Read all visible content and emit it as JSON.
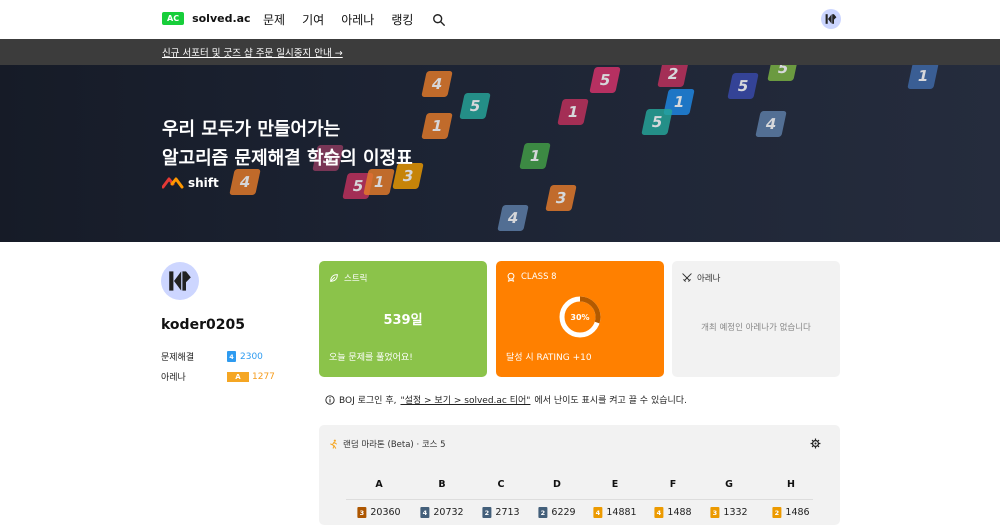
{
  "nav": {
    "logo_badge": "AC",
    "logo_text": "solved.ac",
    "links": [
      "문제",
      "기여",
      "아레나",
      "랭킹"
    ]
  },
  "notice": {
    "text": "신규 서포터 및 굿즈 샵 주문 일시중지 안내 →"
  },
  "hero": {
    "title_line1": "우리 모두가 만들어가는",
    "title_line2": "알고리즘 문제해결 학습의 이정표",
    "brand": "shift"
  },
  "profile": {
    "username": "koder0205",
    "solved_label": "문제해결",
    "solved_tier_digit": "4",
    "solved_value": "2300",
    "arena_label": "아레나",
    "arena_badge": "A",
    "arena_value": "1277"
  },
  "cards": {
    "streak": {
      "label": "스트릭",
      "big": "539일",
      "foot": "오늘 문제를 풀었어요!"
    },
    "class": {
      "label": "CLASS 8",
      "percent_text": "30%",
      "progress": 0.3,
      "foot": "달성 시 RATING +10"
    },
    "arena": {
      "label": "아레나",
      "empty": "개최 예정인 아레나가 없습니다"
    }
  },
  "info": {
    "prefix": "BOJ 로그인 후, ",
    "link": "\"설정 > 보기 > solved.ac 티어\"",
    "suffix": "에서 난이도 표시를 켜고 끌 수 있습니다."
  },
  "marathon": {
    "title": "랜덤 마라톤 (Beta) · 코스 5",
    "columns": [
      {
        "letter": "A",
        "tier_digit": "3",
        "tier_color": "#ad5600",
        "value": "20360"
      },
      {
        "letter": "B",
        "tier_digit": "4",
        "tier_color": "#435f7a",
        "value": "20732"
      },
      {
        "letter": "C",
        "tier_digit": "2",
        "tier_color": "#435f7a",
        "value": "2713"
      },
      {
        "letter": "D",
        "tier_digit": "2",
        "tier_color": "#435f7a",
        "value": "6229"
      },
      {
        "letter": "E",
        "tier_digit": "4",
        "tier_color": "#ec9a00",
        "value": "14881"
      },
      {
        "letter": "F",
        "tier_digit": "4",
        "tier_color": "#ec9a00",
        "value": "1488"
      },
      {
        "letter": "G",
        "tier_digit": "3",
        "tier_color": "#ec9a00",
        "value": "1332"
      },
      {
        "letter": "H",
        "tier_digit": "2",
        "tier_color": "#ec9a00",
        "value": "1486"
      }
    ]
  },
  "colors": {
    "accent_green": "#17ce3a",
    "streak_green": "#8bc34a",
    "class_orange": "#ff8000",
    "notice_bg": "#3c3c3c"
  },
  "hero_tiles": [
    {
      "digit": "5",
      "color": "#d8336b"
    },
    {
      "digit": "2",
      "color": "#c2315d"
    },
    {
      "digit": "5",
      "color": "#7cb342"
    },
    {
      "digit": "4",
      "color": "#e57b2a"
    },
    {
      "digit": "5",
      "color": "#26a69a"
    },
    {
      "digit": "1",
      "color": "#1e88e5"
    },
    {
      "digit": "5",
      "color": "#3949ab"
    },
    {
      "digit": "1",
      "color": "#e57b2a"
    },
    {
      "digit": "1",
      "color": "#c2315d"
    },
    {
      "digit": "5",
      "color": "#26a69a"
    },
    {
      "digit": "1",
      "color": "#43a047"
    },
    {
      "digit": "4",
      "color": "#5e7fa8"
    },
    {
      "digit": "4",
      "color": "#e57b2a"
    },
    {
      "digit": "5",
      "color": "#c2315d"
    },
    {
      "digit": "1",
      "color": "#e57b2a"
    },
    {
      "digit": "3",
      "color": "#ec9a00"
    },
    {
      "digit": "5",
      "color": "#8e3b5f"
    },
    {
      "digit": "4",
      "color": "#5e7fa8"
    },
    {
      "digit": "1",
      "color": "#3f6aa8"
    },
    {
      "digit": "3",
      "color": "#e57b2a"
    }
  ]
}
